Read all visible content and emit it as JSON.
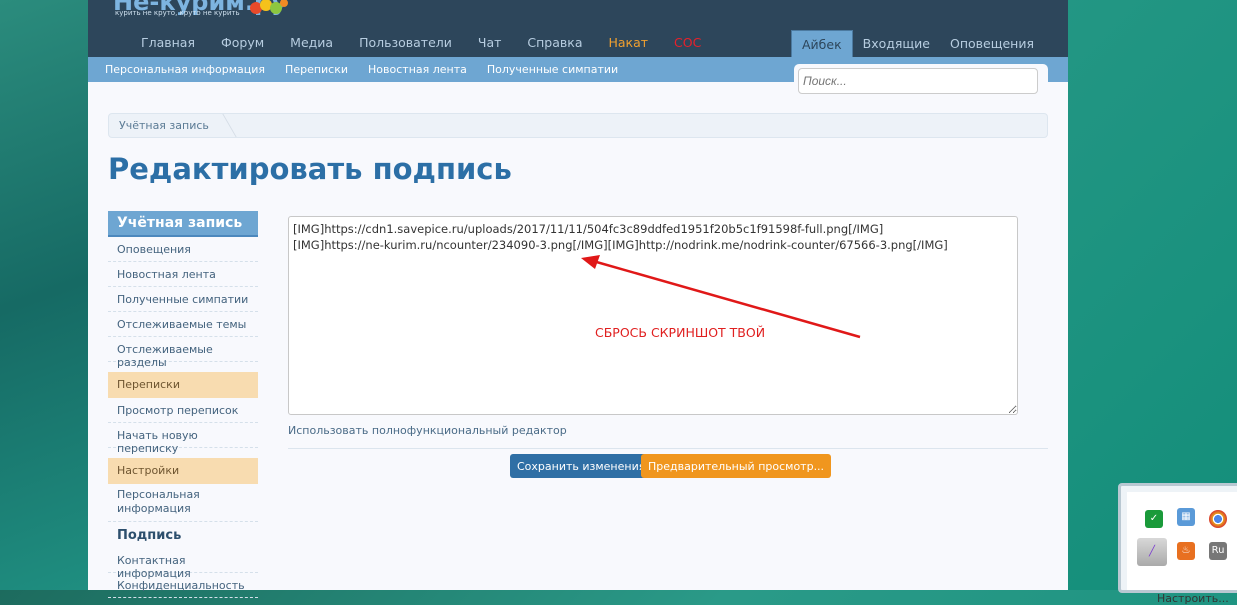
{
  "header": {
    "logo": "Не-курим.ру",
    "tagline": "курить не круто, круто не курить",
    "nav": [
      "Главная",
      "Форум",
      "Медиа",
      "Пользователи",
      "Чат",
      "Справка",
      "Накат",
      "СОС"
    ],
    "user_tabs": [
      "Айбек",
      "Входящие",
      "Оповещения"
    ]
  },
  "subnav": [
    "Персональная информация",
    "Переписки",
    "Новостная лента",
    "Полученные симпатии"
  ],
  "search": {
    "placeholder": "Поиск..."
  },
  "breadcrumb": "Учётная запись",
  "page_title": "Редактировать подпись",
  "sidebar": {
    "header": "Учётная запись",
    "account_items": [
      "Оповещения",
      "Новостная лента",
      "Полученные симпатии",
      "Отслеживаемые темы",
      "Отслеживаемые разделы"
    ],
    "conv_header": "Переписки",
    "conv_items": [
      "Просмотр переписок",
      "Начать новую переписку"
    ],
    "settings_header": "Настройки",
    "settings_items": [
      "Персональная информация",
      "Подпись",
      "Контактная информация",
      "Конфиденциальность"
    ]
  },
  "editor": {
    "value": "[IMG]https://cdn1.savepice.ru/uploads/2017/11/11/504fc3c89ddfed1951f20b5c1f91598f-full.png[/IMG]\n[IMG]https://ne-kurim.ru/ncounter/234090-3.png[/IMG][IMG]http://nodrink.me/nodrink-counter/67566-3.png[/IMG]",
    "annotation": "СБРОСЬ СКРИНШОТ ТВОЙ",
    "full_editor_link": "Использовать полнофункциональный редактор"
  },
  "buttons": {
    "save": "Сохранить изменения",
    "preview": "Предварительный просмотр..."
  },
  "tray": {
    "lang": "Ru",
    "label": "Настроить..."
  }
}
